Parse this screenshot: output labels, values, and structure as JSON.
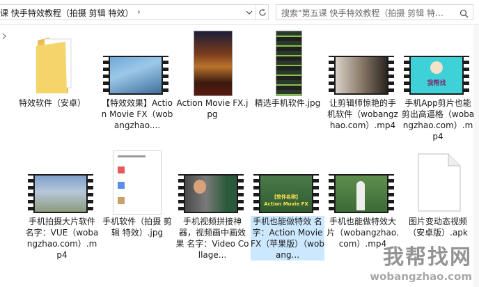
{
  "address": {
    "path": "课 快手特效教程（拍摄 剪辑 特效）",
    "dropdown_icon": "chevron-down-icon",
    "refresh_icon": "refresh-icon"
  },
  "search": {
    "placeholder": "搜索\"第五课 快手特效教程（拍摄 剪辑 特效...",
    "icon": "search-icon"
  },
  "colors": {
    "folder": "#f5d46a",
    "selection": "#cce8ff",
    "film": "#1b1b1b"
  },
  "files": [
    {
      "name": "特效软件（安卓）",
      "type": "folder"
    },
    {
      "name": "【特效效果】Action Movie FX（wobangzhao....",
      "type": "video"
    },
    {
      "name": "Action Movie FX.jpg",
      "type": "image"
    },
    {
      "name": "精选手机软件.jpg",
      "type": "image"
    },
    {
      "name": "让剪辑师惊艳的手机软件（wobangzhao.com）.mp4",
      "type": "video"
    },
    {
      "name": "手机App剪片也能剪出高逼格（wobangzhao.com）.mp4",
      "type": "video"
    },
    {
      "name": "手机拍摄大片软件 名字：VUE（wobangzhao.com）.mp4",
      "type": "video"
    },
    {
      "name": "手机软件（拍摄 剪辑 特效）.jpg",
      "type": "image"
    },
    {
      "name": "手机视频拼接神器，视频画中画效果 名字：Video Collage...",
      "type": "video"
    },
    {
      "name": "手机也能做特效 名字：Action Movie FX（苹果版）（wobang...",
      "type": "video"
    },
    {
      "name": "手机也能做特效大片（wobangzhao.com）.mp4",
      "type": "video"
    },
    {
      "name": "图片变动态视频（安卓版）.apk",
      "type": "file"
    }
  ],
  "thumbs": {
    "video2_label": "【软件名称】",
    "video2_sub": "Action Movie FX",
    "logo_text": "我帮找"
  },
  "watermark": {
    "cn": "我帮找网",
    "en": "wobangzhao.com"
  }
}
